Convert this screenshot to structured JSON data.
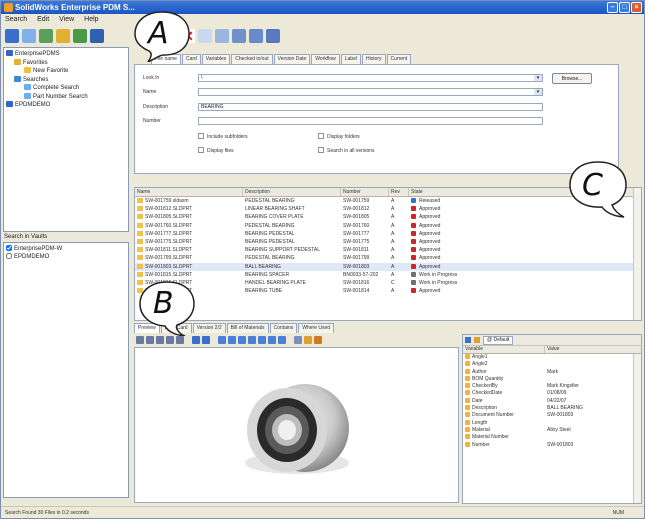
{
  "window": {
    "title": "SolidWorks Enterprise PDM S..."
  },
  "menu": [
    "Search",
    "Edit",
    "View",
    "Help"
  ],
  "toolbar_icons": [
    "search-icon",
    "back-icon",
    "forward-icon",
    "favorite-icon",
    "grid-icon",
    "save-icon",
    "new-icon",
    "delete-icon",
    "open-icon",
    "folder-icon",
    "print-icon",
    "export-icon",
    "chart-icon"
  ],
  "tree": [
    {
      "label": "EnterprisePDMS",
      "icon": "vault-icon"
    },
    {
      "label": "Favorites",
      "icon": "favorites-icon"
    },
    {
      "label": "New Favorite",
      "icon": "favorite-item-icon"
    },
    {
      "label": "Searches",
      "icon": "search-icon"
    },
    {
      "label": "Complete Search",
      "icon": "search-item-icon"
    },
    {
      "label": "Part Number Search",
      "icon": "search-item-icon"
    },
    {
      "label": "EPDMDEMO",
      "icon": "vault-icon"
    }
  ],
  "search_in": {
    "label": "Search in Vaults",
    "items": [
      "EnterprisePDM-W",
      "EPDMDEMO"
    ]
  },
  "form_tabs": [
    "File name",
    "Card",
    "Variables",
    "Checked in/out",
    "Version Date",
    "Workflow",
    "Label",
    "History",
    "Current"
  ],
  "form": {
    "lookin_label": "Look in",
    "lookin_value": "\\",
    "name_label": "Name",
    "name_value": "",
    "desc_label": "Description",
    "desc_value": "BEARING",
    "number_label": "Number",
    "number_value": "",
    "browse_label": "Browse...",
    "include_subfolders": "Include subfolders",
    "display_folders": "Display folders",
    "display_files": "Display files",
    "search_all_versions": "Search in all versions"
  },
  "results": {
    "columns": [
      "Name",
      "Description",
      "Number",
      "Rev",
      "State"
    ],
    "rows": [
      [
        "SW-001759.sldasm",
        "PEDESTAL BEARING",
        "SW-001759",
        "A",
        "Released"
      ],
      [
        "SW-001812.SLDPRT",
        "LINEAR BEARING SHAFT",
        "SW-001812",
        "A",
        "Approved"
      ],
      [
        "SW-001805.SLDPRT",
        "BEARING COVER PLATE",
        "SW-001805",
        "A",
        "Approved"
      ],
      [
        "SW-001760.SLDPRT",
        "PEDESTAL BEARING",
        "SW-001760",
        "A",
        "Approved"
      ],
      [
        "SW-001777.SLDPRT",
        "BEARING PEDESTAL",
        "SW-001777",
        "A",
        "Approved"
      ],
      [
        "SW-001775.SLDPRT",
        "BEARING PEDESTAL",
        "SW-001775",
        "A",
        "Approved"
      ],
      [
        "SW-001811.SLDPRT",
        "BEARING SUPPORT PEDESTAL",
        "SW-001811",
        "A",
        "Approved"
      ],
      [
        "SW-001799.SLDPRT",
        "PEDESTAL BEARING",
        "SW-001799",
        "A",
        "Approved"
      ],
      [
        "SW-001803.SLDPRT",
        "BALL BEARING",
        "SW-001803",
        "A",
        "Approved"
      ],
      [
        "SW-001815.SLDPRT",
        "BEARING SPACER",
        "BN0033-57-202",
        "A",
        "Work in Progress"
      ],
      [
        "SW-001816.SLDPRT",
        "HANDEL BEARING PLATE",
        "SW-001816",
        "C",
        "Work in Progress"
      ],
      [
        "SW-001814.SLDPRT",
        "BEARING TUBE",
        "SW-001814",
        "A",
        "Approved"
      ]
    ]
  },
  "bottom_tabs": [
    "Preview",
    "Data Card",
    "Version 2/2",
    "Bill of Materials",
    "Contains",
    "Where Used"
  ],
  "props": {
    "tab_label": "@ Default",
    "columns": [
      "Variable",
      "Value"
    ],
    "rows": [
      [
        "Angle1",
        ""
      ],
      [
        "Angle2",
        ""
      ],
      [
        "Author",
        "Mark"
      ],
      [
        "BOM Quantity",
        ""
      ],
      [
        "CheckedBy",
        "Mark Kingsfier"
      ],
      [
        "CheckedDate",
        "01/08/09"
      ],
      [
        "Date",
        "04/22/07"
      ],
      [
        "Description",
        "BALL BEARING"
      ],
      [
        "Document Number",
        "SW-001803"
      ],
      [
        "Length",
        ""
      ],
      [
        "Material",
        "Alloy Steel"
      ],
      [
        "Material Number",
        ""
      ],
      [
        "Number",
        "SW-001803"
      ]
    ]
  },
  "status": {
    "left": "Search Found 30 Files in 0.2 seconds",
    "right": "NUM"
  },
  "callouts": {
    "a": "A",
    "b": "B",
    "c": "C"
  }
}
